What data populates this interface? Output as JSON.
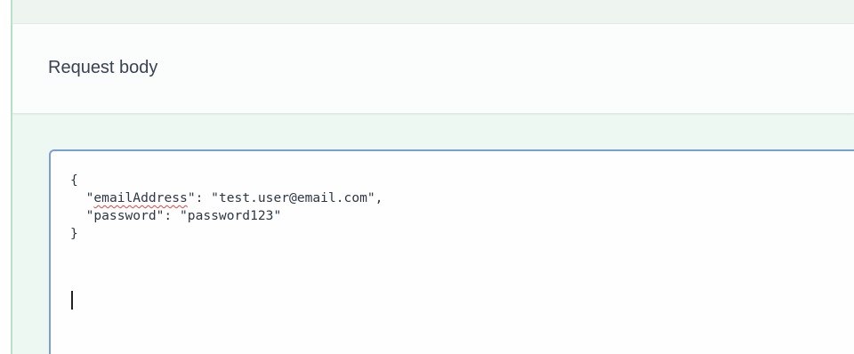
{
  "section": {
    "title": "Request body"
  },
  "request_body": {
    "lines": [
      {
        "text": "{"
      },
      {
        "indent": "  ",
        "quote_open": "\"",
        "key": "emailAddress",
        "rest": "\": \"test.user@email.com\","
      },
      {
        "text": "  \"password\": \"password123\""
      },
      {
        "text": "}"
      }
    ]
  },
  "colors": {
    "panel_green": "#eef8f2",
    "left_border": "#b9e1c7",
    "focus_border": "#7a9fd6",
    "title_text": "#3b4151",
    "spellcheck_underline": "#e0453e"
  }
}
